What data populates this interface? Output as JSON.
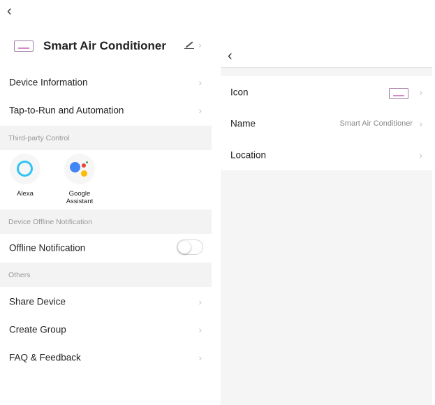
{
  "left": {
    "device_name": "Smart Air Conditioner",
    "rows": {
      "device_information": "Device Information",
      "tap_to_run": "Tap-to-Run and Automation"
    },
    "sections": {
      "third_party": "Third-party Control",
      "offline": "Device Offline Notification",
      "others": "Others"
    },
    "third_party_items": [
      {
        "label": "Alexa",
        "icon": "alexa-icon"
      },
      {
        "label": "Google\nAssistant",
        "icon": "google-assistant-icon"
      }
    ],
    "offline_notification": {
      "label": "Offline Notification",
      "enabled": false
    },
    "others_items": [
      "Share Device",
      "Create Group",
      "FAQ & Feedback"
    ]
  },
  "right": {
    "rows": {
      "icon_label": "Icon",
      "name_label": "Name",
      "name_value": "Smart Air Conditioner",
      "location_label": "Location"
    }
  },
  "colors": {
    "section_bg": "#f3f3f3",
    "alexa": "#31c4f3",
    "google_blue": "#4285f4",
    "google_red": "#ea4335",
    "google_yellow": "#fbbc05",
    "google_green": "#34a853",
    "ac_icon_accent": "#d48ac9"
  }
}
